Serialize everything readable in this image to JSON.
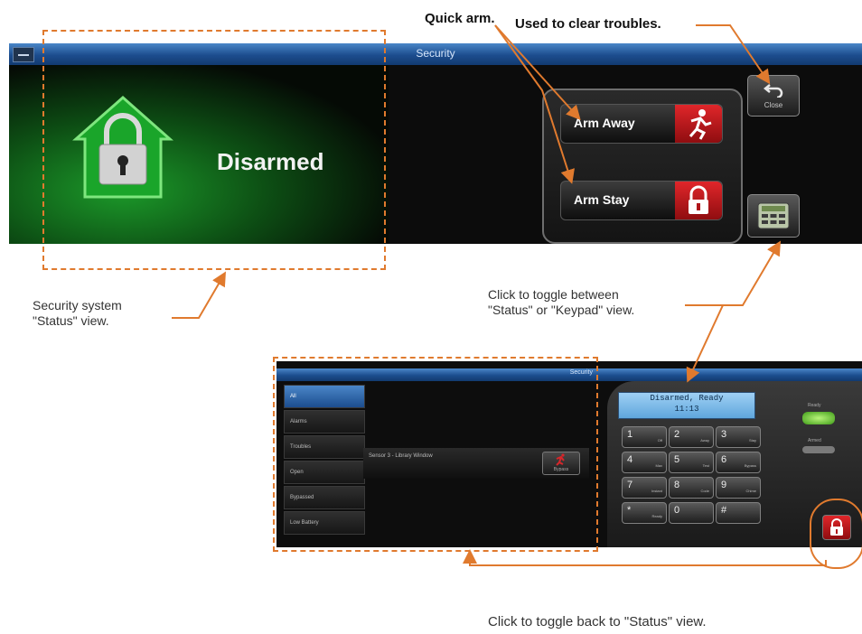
{
  "top_panel": {
    "title": "Security",
    "status": "Disarmed",
    "arm_away": "Arm Away",
    "arm_stay": "Arm Stay",
    "close": "Close"
  },
  "annotations": {
    "quick_arm": "Quick arm.",
    "clear_troubles": "Used to clear troubles.",
    "status_view": [
      "Security system",
      "\"Status\" view."
    ],
    "toggle_view": [
      "Click to toggle between",
      "\"Status\" or \"Keypad\" view."
    ],
    "toggle_back": "Click to toggle back to \"Status\" view."
  },
  "bottom_panel": {
    "title": "Security",
    "sidebar": [
      "All",
      "Alarms",
      "Troubles",
      "Open",
      "Bypassed",
      "Low Battery"
    ],
    "sensor": "Sensor 3 - Library Window",
    "bypass": "Bypass",
    "lcd_line1": "Disarmed, Ready",
    "lcd_line2": "11:13",
    "ready": "Ready",
    "armed": "Armed",
    "keys": [
      {
        "digit": "1",
        "sub": "Off"
      },
      {
        "digit": "2",
        "sub": "Away"
      },
      {
        "digit": "3",
        "sub": "Stay"
      },
      {
        "digit": "4",
        "sub": "Max"
      },
      {
        "digit": "5",
        "sub": "Test"
      },
      {
        "digit": "6",
        "sub": "Bypass"
      },
      {
        "digit": "7",
        "sub": "Instant"
      },
      {
        "digit": "8",
        "sub": "Code"
      },
      {
        "digit": "9",
        "sub": "Chime"
      },
      {
        "digit": "*",
        "sub": "Ready"
      },
      {
        "digit": "0",
        "sub": ""
      },
      {
        "digit": "#",
        "sub": ""
      }
    ]
  },
  "colors": {
    "accent_blue": "#1c4d8e",
    "annotation_orange": "#e07a2e",
    "arm_red": "#d8262a",
    "ready_green": "#5fc42a"
  }
}
